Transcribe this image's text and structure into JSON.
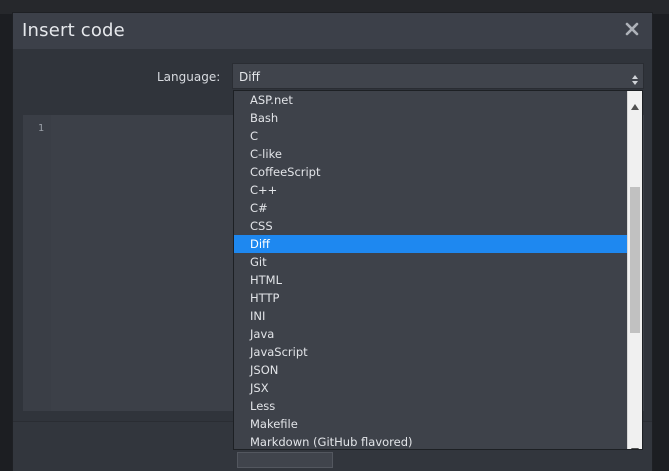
{
  "dialog": {
    "title": "Insert code",
    "close_icon": "close-icon"
  },
  "language": {
    "label": "Language:",
    "selected": "Diff",
    "select_icon": "select-arrows-icon"
  },
  "editor": {
    "line_numbers": [
      "1"
    ]
  },
  "dropdown": {
    "options": [
      {
        "label": "ASP.net",
        "selected": false
      },
      {
        "label": "Bash",
        "selected": false
      },
      {
        "label": "C",
        "selected": false
      },
      {
        "label": "C-like",
        "selected": false
      },
      {
        "label": "CoffeeScript",
        "selected": false
      },
      {
        "label": "C++",
        "selected": false
      },
      {
        "label": "C#",
        "selected": false
      },
      {
        "label": "CSS",
        "selected": false
      },
      {
        "label": "Diff",
        "selected": true
      },
      {
        "label": "Git",
        "selected": false
      },
      {
        "label": "HTML",
        "selected": false
      },
      {
        "label": "HTTP",
        "selected": false
      },
      {
        "label": "INI",
        "selected": false
      },
      {
        "label": "Java",
        "selected": false
      },
      {
        "label": "JavaScript",
        "selected": false
      },
      {
        "label": "JSON",
        "selected": false
      },
      {
        "label": "JSX",
        "selected": false
      },
      {
        "label": "Less",
        "selected": false
      },
      {
        "label": "Makefile",
        "selected": false
      },
      {
        "label": "Markdown (GitHub flavored)",
        "selected": false
      }
    ],
    "scrollbar": {
      "up_icon": "scroll-up-icon",
      "down_icon": "scroll-down-icon"
    }
  },
  "colors": {
    "dialog_bg": "#363a42",
    "selected_option": "#1e88f0",
    "text": "#e2e4e8"
  }
}
